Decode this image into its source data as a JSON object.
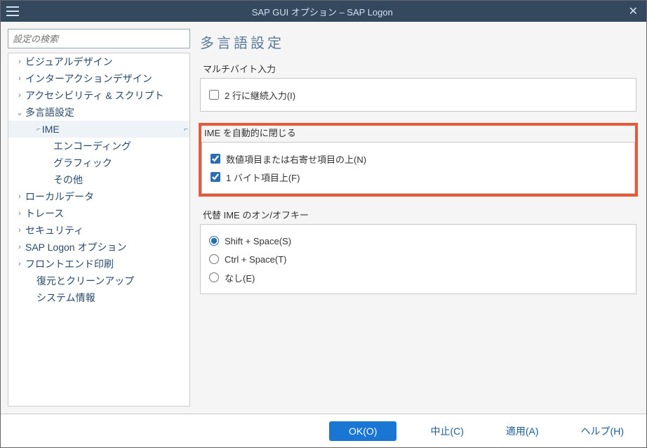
{
  "window": {
    "title": "SAP GUI オプション – SAP Logon"
  },
  "search": {
    "placeholder": "設定の検索"
  },
  "tree": {
    "items": [
      {
        "label": "ビジュアルデザイン",
        "depth": 0,
        "arrow": "›",
        "interact": true
      },
      {
        "label": "インターアクションデザイン",
        "depth": 0,
        "arrow": "›",
        "interact": true
      },
      {
        "label": "アクセシビリティ & スクリプト",
        "depth": 0,
        "arrow": "›",
        "interact": true
      },
      {
        "label": "多言語設定",
        "depth": 0,
        "arrow": "⌄",
        "interact": true
      },
      {
        "label": "IME",
        "depth": 1,
        "arrow": "",
        "interact": true,
        "selected": true
      },
      {
        "label": "エンコーディング",
        "depth": 2,
        "arrow": "",
        "interact": true
      },
      {
        "label": "グラフィック",
        "depth": 2,
        "arrow": "",
        "interact": true
      },
      {
        "label": "その他",
        "depth": 2,
        "arrow": "",
        "interact": true
      },
      {
        "label": "ローカルデータ",
        "depth": 0,
        "arrow": "›",
        "interact": true
      },
      {
        "label": "トレース",
        "depth": 0,
        "arrow": "›",
        "interact": true
      },
      {
        "label": "セキュリティ",
        "depth": 0,
        "arrow": "›",
        "interact": true
      },
      {
        "label": "SAP Logon オプション",
        "depth": 0,
        "arrow": "›",
        "interact": true
      },
      {
        "label": "フロントエンド印刷",
        "depth": 0,
        "arrow": "›",
        "interact": true
      },
      {
        "label": "復元とクリーンアップ",
        "depth": 1,
        "arrow": "",
        "interact": true
      },
      {
        "label": "システム情報",
        "depth": 1,
        "arrow": "",
        "interact": true
      }
    ]
  },
  "main": {
    "title": "多言語設定",
    "groups": [
      {
        "label": "マルチバイト入力",
        "highlighted": false,
        "controls": [
          {
            "type": "checkbox",
            "label": "2 行に継続入力(I)",
            "checked": false
          }
        ]
      },
      {
        "label": "IME を自動的に閉じる",
        "highlighted": true,
        "controls": [
          {
            "type": "checkbox",
            "label": "数値項目または右寄せ項目の上(N)",
            "checked": true
          },
          {
            "type": "checkbox",
            "label": "1 バイト項目上(F)",
            "checked": true
          }
        ]
      },
      {
        "label": "代替 IME のオン/オフキー",
        "highlighted": false,
        "controls": [
          {
            "type": "radio",
            "label": "Shift + Space(S)",
            "checked": true
          },
          {
            "type": "radio",
            "label": "Ctrl + Space(T)",
            "checked": false
          },
          {
            "type": "radio",
            "label": "なし(E)",
            "checked": false
          }
        ]
      }
    ]
  },
  "footer": {
    "ok": "OK(O)",
    "cancel": "中止(C)",
    "apply": "適用(A)",
    "help": "ヘルプ(H)"
  }
}
